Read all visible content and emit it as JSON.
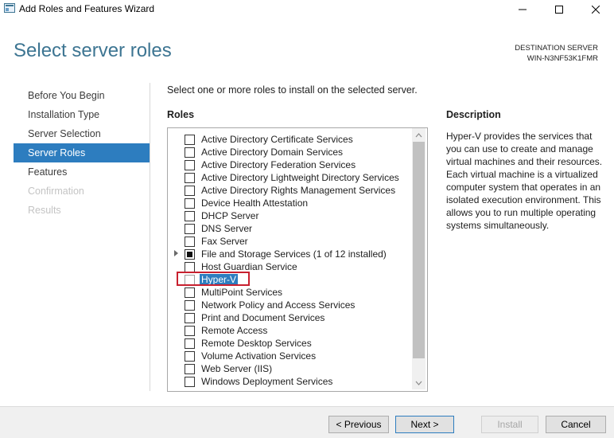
{
  "window": {
    "title": "Add Roles and Features Wizard",
    "icons": [
      "wizard-app-icon",
      "minimize-icon",
      "maximize-icon",
      "close-icon"
    ]
  },
  "header": {
    "page_title": "Select server roles",
    "destination_label": "DESTINATION SERVER",
    "destination_server": "WIN-N3NF53K1FMR"
  },
  "nav": {
    "items": [
      {
        "label": "Before You Begin",
        "state": "normal"
      },
      {
        "label": "Installation Type",
        "state": "normal"
      },
      {
        "label": "Server Selection",
        "state": "normal"
      },
      {
        "label": "Server Roles",
        "state": "active"
      },
      {
        "label": "Features",
        "state": "normal"
      },
      {
        "label": "Confirmation",
        "state": "disabled"
      },
      {
        "label": "Results",
        "state": "disabled"
      }
    ]
  },
  "main": {
    "instruction": "Select one or more roles to install on the selected server.",
    "roles_heading": "Roles",
    "roles": [
      {
        "label": "Active Directory Certificate Services",
        "checked": "none"
      },
      {
        "label": "Active Directory Domain Services",
        "checked": "none"
      },
      {
        "label": "Active Directory Federation Services",
        "checked": "none"
      },
      {
        "label": "Active Directory Lightweight Directory Services",
        "checked": "none"
      },
      {
        "label": "Active Directory Rights Management Services",
        "checked": "none"
      },
      {
        "label": "Device Health Attestation",
        "checked": "none"
      },
      {
        "label": "DHCP Server",
        "checked": "none"
      },
      {
        "label": "DNS Server",
        "checked": "none"
      },
      {
        "label": "Fax Server",
        "checked": "none"
      },
      {
        "label": "File and Storage Services (1 of 12 installed)",
        "checked": "partial",
        "expandable": true
      },
      {
        "label": "Host Guardian Service",
        "checked": "none"
      },
      {
        "label": "Hyper-V",
        "checked": "none",
        "selected": true
      },
      {
        "label": "MultiPoint Services",
        "checked": "none"
      },
      {
        "label": "Network Policy and Access Services",
        "checked": "none"
      },
      {
        "label": "Print and Document Services",
        "checked": "none"
      },
      {
        "label": "Remote Access",
        "checked": "none"
      },
      {
        "label": "Remote Desktop Services",
        "checked": "none"
      },
      {
        "label": "Volume Activation Services",
        "checked": "none"
      },
      {
        "label": "Web Server (IIS)",
        "checked": "none"
      },
      {
        "label": "Windows Deployment Services",
        "checked": "none"
      }
    ]
  },
  "description": {
    "heading": "Description",
    "text": "Hyper-V provides the services that you can use to create and manage virtual machines and their resources. Each virtual machine is a virtualized computer system that operates in an isolated execution environment. This allows you to run multiple operating systems simultaneously."
  },
  "footer": {
    "previous_label": "< Previous",
    "next_label": "Next >",
    "install_label": "Install",
    "cancel_label": "Cancel"
  },
  "colors": {
    "accent": "#2d7dbf",
    "title": "#3d7592",
    "highlight": "#c8202f"
  }
}
